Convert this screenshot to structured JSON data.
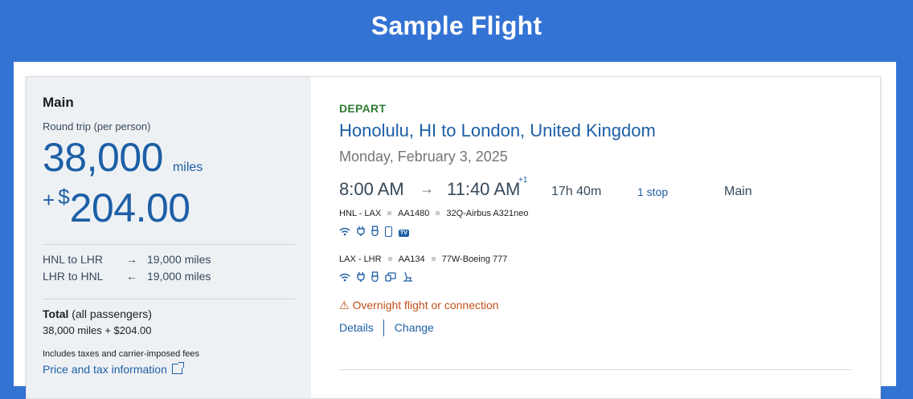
{
  "banner": {
    "title": "Sample Flight"
  },
  "fare": {
    "cabin": "Main",
    "trip_type": "Round trip (per person)",
    "miles": "38,000",
    "miles_unit": "miles",
    "plus": "+",
    "currency_symbol": "$",
    "cash": "204.00",
    "segments": [
      {
        "route": "HNL to LHR",
        "arrow": "→",
        "miles": "19,000 miles"
      },
      {
        "route": "LHR to HNL",
        "arrow": "←",
        "miles": "19,000 miles"
      }
    ],
    "total_label": "Total",
    "total_qualifier": "(all passengers)",
    "total_value": "38,000 miles + $204.00",
    "fees_note": "Includes taxes and carrier-imposed fees",
    "price_link": "Price and tax information"
  },
  "flight": {
    "direction": "DEPART",
    "route": "Honolulu, HI to London, United Kingdom",
    "date": "Monday, February 3, 2025",
    "depart_time": "8:00 AM",
    "arrow": "→",
    "arrive_time": "11:40 AM",
    "day_offset": "+1",
    "duration": "17h 40m",
    "stops": "1 stop",
    "cabin": "Main",
    "legs": [
      {
        "route": "HNL - LAX",
        "flight": "AA1480",
        "aircraft": "32Q-Airbus A321neo",
        "amenities": [
          "wifi-icon",
          "power-icon",
          "usb-icon",
          "device-icon",
          "tv-icon"
        ]
      },
      {
        "route": "LAX - LHR",
        "flight": "AA134",
        "aircraft": "77W-Boeing 777",
        "amenities": [
          "wifi-icon",
          "power-icon",
          "usb-icon",
          "entertainment-icon",
          "seat-icon"
        ]
      }
    ],
    "tv_badge": "TV",
    "overnight_icon": "⚠",
    "overnight_text": "Overnight flight or connection",
    "details_link": "Details",
    "change_link": "Change"
  },
  "colors": {
    "banner_bg": "#3373d4",
    "link_blue": "#1d5fa6",
    "depart_green": "#2e7d32",
    "warning_orange": "#c0501a"
  }
}
